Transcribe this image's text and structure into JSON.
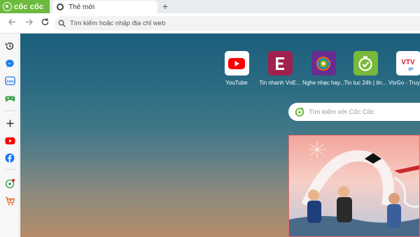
{
  "browser": {
    "brand": "cốc cốc",
    "tab_title": "Thẻ mới",
    "newtab_label": "+",
    "address_placeholder": "Tìm kiếm hoặc nhập địa chỉ web"
  },
  "sidebar": {
    "items": [
      "history-icon",
      "messenger-icon",
      "zalo-icon",
      "game-icon",
      "add-icon",
      "youtube-icon",
      "facebook-icon",
      "coccoc-game-icon",
      "shopping-icon"
    ]
  },
  "shortcuts": [
    {
      "label": "YouTube",
      "icon": "youtube-icon",
      "color": "#ffffff"
    },
    {
      "label": "Tin nhanh VnE...",
      "icon": "vnexpress-icon",
      "color": "#9f224e"
    },
    {
      "label": "Nghe nhạc hay...",
      "icon": "music-icon",
      "color": "#6a2c91"
    },
    {
      "label": "Tin tuc 24h | tin...",
      "icon": "news24h-icon",
      "color": "#78b83a"
    },
    {
      "label": "VtvGo - Truyề...",
      "icon": "vtvgo-icon",
      "color": "#ffffff"
    }
  ],
  "search": {
    "placeholder": "Tìm kiếm với Cốc Cốc"
  },
  "colors": {
    "brand": "#6cbb3c",
    "youtube": "#ff0000",
    "vnexpress": "#9f224e"
  }
}
